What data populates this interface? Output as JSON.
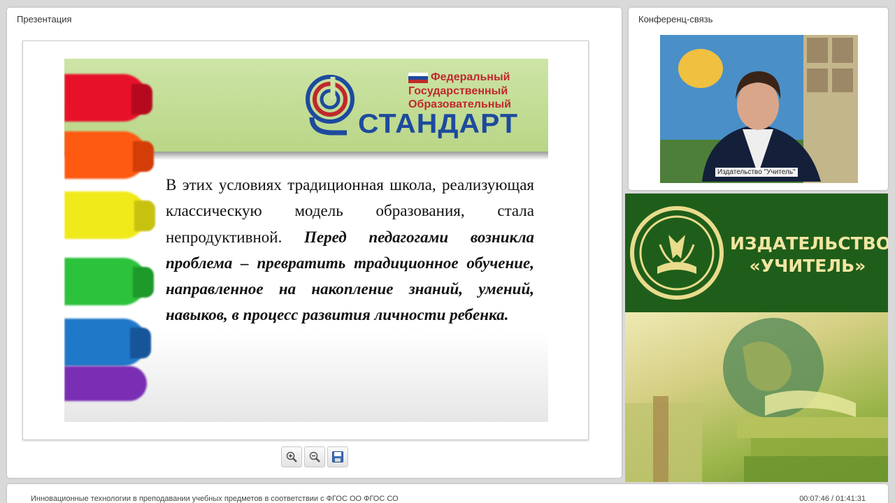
{
  "presentation_panel": {
    "title": "Презентация"
  },
  "conference_panel": {
    "title": "Конференц-связь",
    "speaker_caption": "Издательство \"Учитель\""
  },
  "slide": {
    "header": {
      "fgos_lines": [
        "Федеральный",
        "Государственный",
        "Образовательный"
      ],
      "standard_word": "СТАНДАРТ"
    },
    "body_plain": "В этих условиях традиционная школа, реализующая классическую модель образования, стала непродуктивной.",
    "body_emphasis": "Перед педагогами возникла проблема – превратить традиционное обучение, направленное на накопление знаний, умений, навыков, в процесс развития личности ребенка."
  },
  "toolbar": {
    "icons": [
      "zoom-in-icon",
      "zoom-out-icon",
      "save-icon"
    ]
  },
  "publisher_banner": {
    "name_line1": "ИЗДАТЕЛЬСТВО",
    "name_line2": "«УЧИТЕЛЬ»"
  },
  "status_bar": {
    "webinar_title": "Инновационные технологии в преподавании учебных предметов в соответствии с ФГОС ОО ФГОС СО",
    "time": "00:07:46 / 01:41:31"
  },
  "colors": {
    "background": "#d9d9d9",
    "slide_header_green": "#c4de98",
    "fgos_red": "#c0282d",
    "fgos_blue": "#1d4a9e",
    "publisher_green": "#1f5e1a",
    "publisher_gold": "#f2e6a2"
  }
}
